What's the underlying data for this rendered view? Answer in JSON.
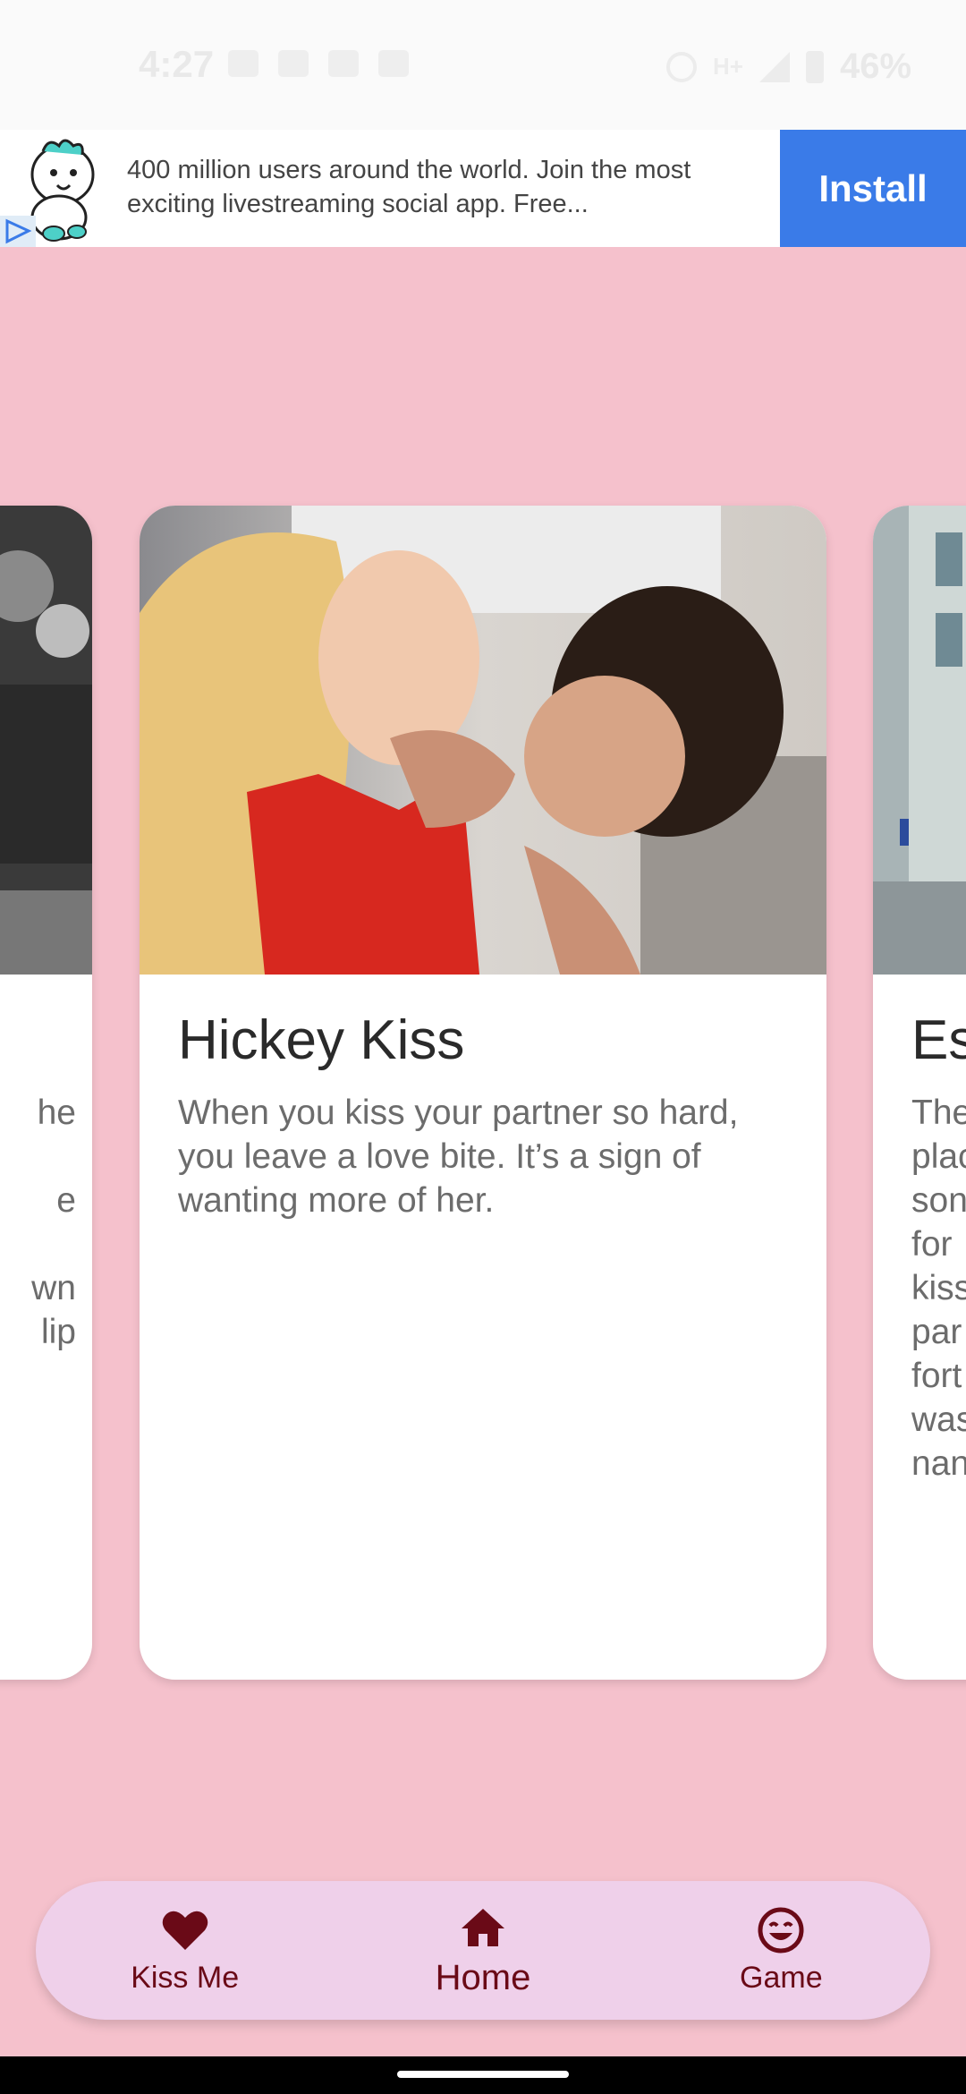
{
  "status_bar": {
    "time": "4:27",
    "network": "H+",
    "battery": "46%"
  },
  "ad": {
    "text": "400 million users around the world. Join the most exciting livestreaming social app. Free...",
    "install_label": "Install"
  },
  "cards": {
    "left": {
      "desc_fragment": "he\n\ne\n\nwn\n lip"
    },
    "main": {
      "title": "Hickey Kiss",
      "description": "When you kiss your partner so hard, you leave a love bite. It’s a sign of wanting more of her."
    },
    "right": {
      "title": "Es",
      "desc_fragment": "The\nplac\nson\nfor\nkiss\npar\nfort\nwas\nnan"
    }
  },
  "nav": {
    "items": [
      {
        "label": "Kiss Me",
        "icon": "heart-icon"
      },
      {
        "label": "Home",
        "icon": "home-icon"
      },
      {
        "label": "Game",
        "icon": "smiley-icon"
      }
    ],
    "active": "Home",
    "accent_color": "#6a0a17",
    "background_color": "#efd0ea"
  },
  "colors": {
    "page_background": "#f5c1cc",
    "install_button": "#3a7be8"
  }
}
